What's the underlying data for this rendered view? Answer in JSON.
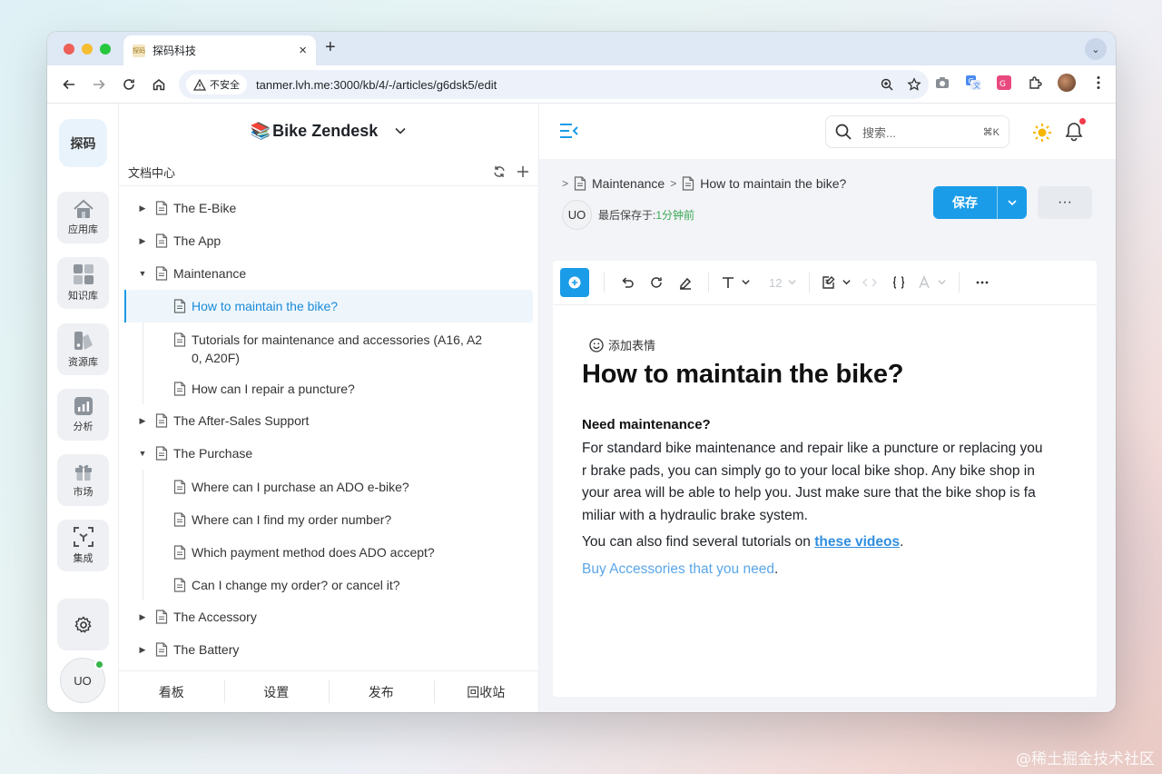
{
  "browser": {
    "tab_title": "探码科技",
    "insecure_label": "不安全",
    "url": "tanmer.lvh.me:3000/kb/4/-/articles/g6dsk5/edit"
  },
  "rail": {
    "logo": "探码",
    "items": [
      {
        "label": "应用库",
        "icon": "home-icon"
      },
      {
        "label": "知识库",
        "icon": "grid-icon"
      },
      {
        "label": "资源库",
        "icon": "resource-icon"
      },
      {
        "label": "分析",
        "icon": "chart-icon"
      },
      {
        "label": "市场",
        "icon": "gift-icon"
      },
      {
        "label": "集成",
        "icon": "integration-icon"
      }
    ],
    "avatar": "UO"
  },
  "kb": {
    "emoji": "📚",
    "name": "Bike Zendesk",
    "section_title": "文档中心",
    "tree": [
      {
        "label": "The E-Bike",
        "expanded": false
      },
      {
        "label": "The App",
        "expanded": false
      },
      {
        "label": "Maintenance",
        "expanded": true,
        "children": [
          {
            "label": "How to maintain the bike?",
            "active": true
          },
          {
            "label": "Tutorials for maintenance and accessories (A16, A2",
            "label2": "0, A20F)"
          },
          {
            "label": "How can I repair a puncture?"
          }
        ]
      },
      {
        "label": "The After-Sales Support",
        "expanded": false
      },
      {
        "label": "The Purchase",
        "expanded": true,
        "children": [
          {
            "label": "Where can I purchase an ADO e-bike?"
          },
          {
            "label": "Where can I find my order number?"
          },
          {
            "label": "Which payment method does ADO accept?"
          },
          {
            "label": "Can I change my order? or cancel it?"
          }
        ]
      },
      {
        "label": "The Accessory",
        "expanded": false
      },
      {
        "label": "The Battery",
        "expanded": false
      }
    ],
    "footer": [
      "看板",
      "设置",
      "发布",
      "回收站"
    ]
  },
  "topbar": {
    "search_placeholder": "搜索...",
    "shortcut": "⌘K"
  },
  "article": {
    "breadcrumb": [
      "Maintenance",
      "How to maintain the bike?"
    ],
    "avatar": "UO",
    "last_saved_label": "最后保存于:",
    "last_saved_time": "1分钟前",
    "save_label": "保存",
    "more_label": "···",
    "font_size": "12",
    "add_emoji": "添加表情",
    "title": "How to maintain the bike?",
    "heading": "Need maintenance?",
    "para1_line1": "For standard bike maintenance and repair like a puncture or replacing you",
    "para1_line2": "r brake pads, you can simply go to your local bike shop. Any bike shop in",
    "para1_line3": "your area will be able to help you. Just make sure that the bike shop is fa",
    "para1_line4": "miliar with a hydraulic brake system.",
    "para2_prefix": "You can also find several tutorials on ",
    "para2_link": "these videos",
    "para2_suffix": ".",
    "para3_link": "Buy Accessories that you need",
    "para3_suffix": "."
  },
  "watermark": "@稀土掘金技术社区",
  "colors": {
    "accent": "#1a9ce8",
    "active_text": "#1a8ad8",
    "saved_time": "#39a853",
    "notification_dot": "#f03a4b",
    "online_dot": "#38b44a"
  }
}
